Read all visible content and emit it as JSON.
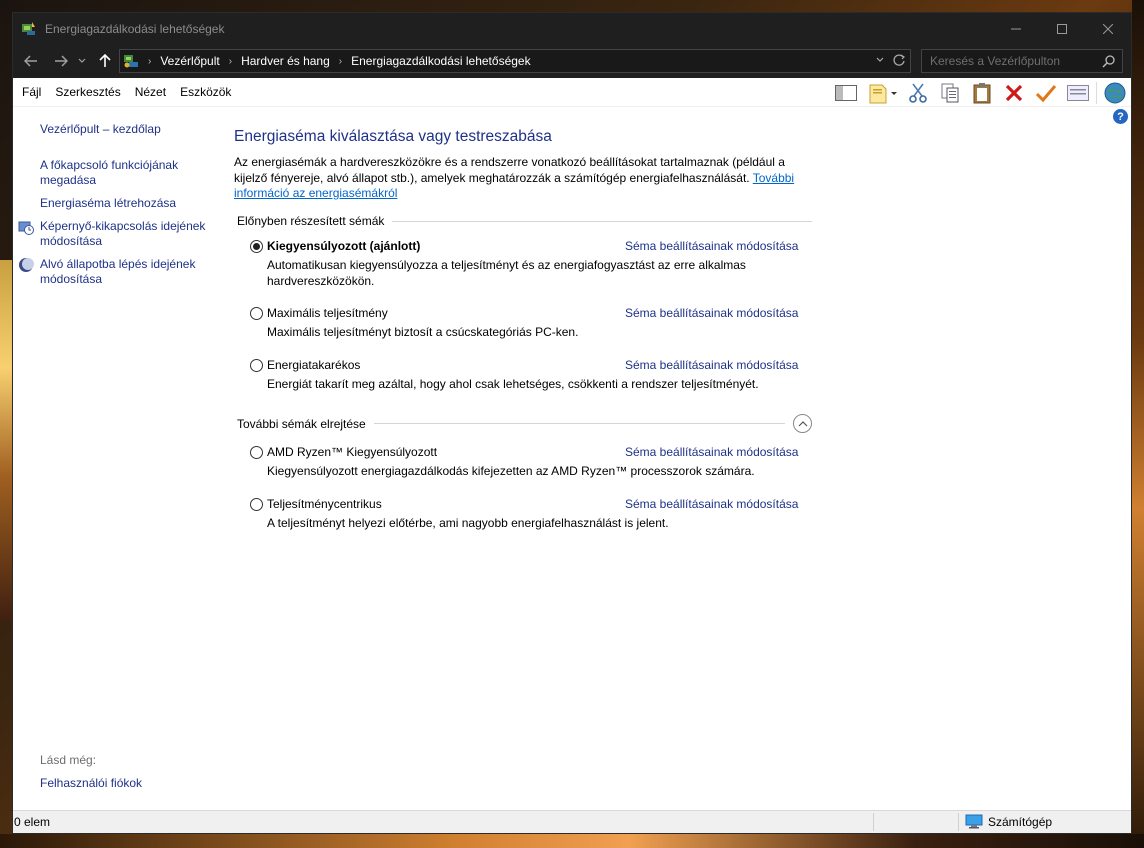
{
  "window": {
    "title": "Energiagazdálkodási lehetőségek"
  },
  "nav": {
    "breadcrumb": [
      "Vezérlőpult",
      "Hardver és hang",
      "Energiagazdálkodási lehetőségek"
    ],
    "search_placeholder": "Keresés a Vezérlőpulton"
  },
  "menu": {
    "items": [
      "Fájl",
      "Szerkesztés",
      "Nézet",
      "Eszközök"
    ]
  },
  "sidebar": {
    "home": "Vezérlőpult – kezdőlap",
    "links": [
      "A főkapcsoló funkciójának megadása",
      "Energiaséma létrehozása",
      "Képernyő-kikapcsolás idejének módosítása",
      "Alvó állapotba lépés idejének módosítása"
    ],
    "see_also_label": "Lásd még:",
    "see_also_links": [
      "Felhasználói fiókok"
    ]
  },
  "main": {
    "title": "Energiaséma kiválasztása vagy testreszabása",
    "description": "Az energiasémák a hardvereszközökre és a rendszerre vonatkozó beállításokat tartalmaznak (például a kijelző fényereje, alvó állapot stb.), amelyek meghatározzák a számítógép energiafelhasználását. ",
    "more_info_link": "További információ az energiasémákról",
    "preferred_heading": "Előnyben részesített sémák",
    "hide_heading": "További sémák elrejtése",
    "settings_link": "Séma beállításainak módosítása",
    "preferred_plans": [
      {
        "name": "Kiegyensúlyozott (ajánlott)",
        "desc": "Automatikusan kiegyensúlyozza a teljesítményt és az energiafogyasztást az erre alkalmas hardvereszközökön.",
        "selected": true
      },
      {
        "name": "Maximális teljesítmény",
        "desc": "Maximális teljesítményt biztosít a csúcskategóriás PC-ken.",
        "selected": false
      },
      {
        "name": "Energiatakarékos",
        "desc": "Energiát takarít meg azáltal, hogy ahol csak lehetséges, csökkenti a rendszer teljesítményét.",
        "selected": false
      }
    ],
    "extra_plans": [
      {
        "name": "AMD Ryzen™ Kiegyensúlyozott",
        "desc": "Kiegyensúlyozott energiagazdálkodás kifejezetten az AMD Ryzen™ processzorok számára.",
        "selected": false
      },
      {
        "name": "Teljesítménycentrikus",
        "desc": "A teljesítményt helyezi előtérbe, ami nagyobb energiafelhasználást is jelent.",
        "selected": false
      }
    ]
  },
  "status": {
    "items_count": "0 elem",
    "location": "Számítógép"
  },
  "colors": {
    "link": "#1e3287",
    "hyperlink": "#0066cc",
    "titlebar": "#1f1f1f"
  }
}
